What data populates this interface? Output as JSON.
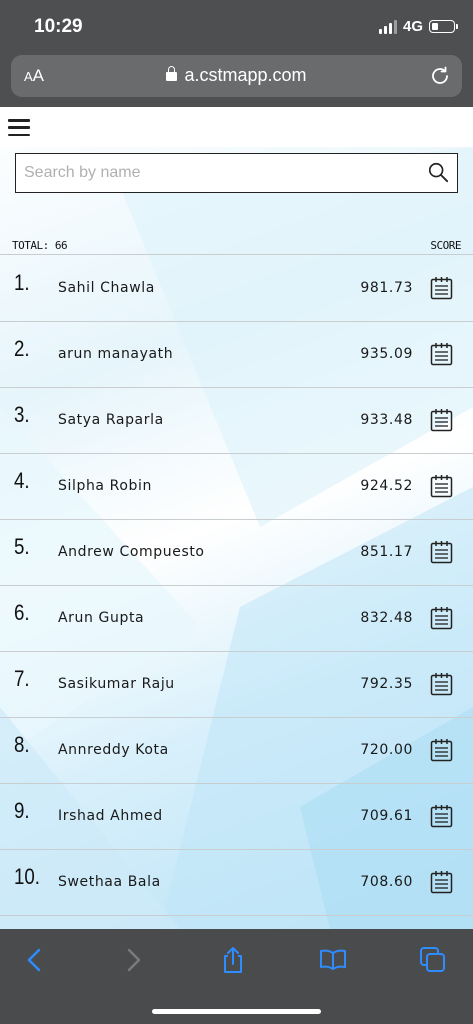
{
  "status_bar": {
    "time": "10:29",
    "network": "4G",
    "battery_level": 0.25
  },
  "browser": {
    "text_size_label_small": "A",
    "text_size_label_large": "A",
    "url": "a.cstmapp.com"
  },
  "search": {
    "placeholder": "Search by name",
    "value": ""
  },
  "list": {
    "total_label": "TOTAL: 66",
    "score_header": "SCORE",
    "rows": [
      {
        "rank": "1.",
        "name": "Sahil Chawla",
        "score": "981.73"
      },
      {
        "rank": "2.",
        "name": "arun manayath",
        "score": "935.09"
      },
      {
        "rank": "3.",
        "name": "Satya Raparla",
        "score": "933.48"
      },
      {
        "rank": "4.",
        "name": "Silpha Robin",
        "score": "924.52"
      },
      {
        "rank": "5.",
        "name": "Andrew Compuesto",
        "score": "851.17"
      },
      {
        "rank": "6.",
        "name": "Arun Gupta",
        "score": "832.48"
      },
      {
        "rank": "7.",
        "name": "Sasikumar Raju",
        "score": "792.35"
      },
      {
        "rank": "8.",
        "name": "Annreddy Kota",
        "score": "720.00"
      },
      {
        "rank": "9.",
        "name": "Irshad Ahmed",
        "score": "709.61"
      },
      {
        "rank": "10.",
        "name": "Swethaa Bala",
        "score": "708.60"
      }
    ]
  },
  "icons": {
    "menu": "hamburger-menu-icon",
    "search": "search-icon",
    "row_action": "calendar-icon",
    "toolbar": [
      "back-icon",
      "forward-icon",
      "share-icon",
      "bookmarks-icon",
      "tabs-icon"
    ]
  },
  "colors": {
    "toolbar_accent": "#2f8cff",
    "chrome_bg": "#4e4f51"
  }
}
